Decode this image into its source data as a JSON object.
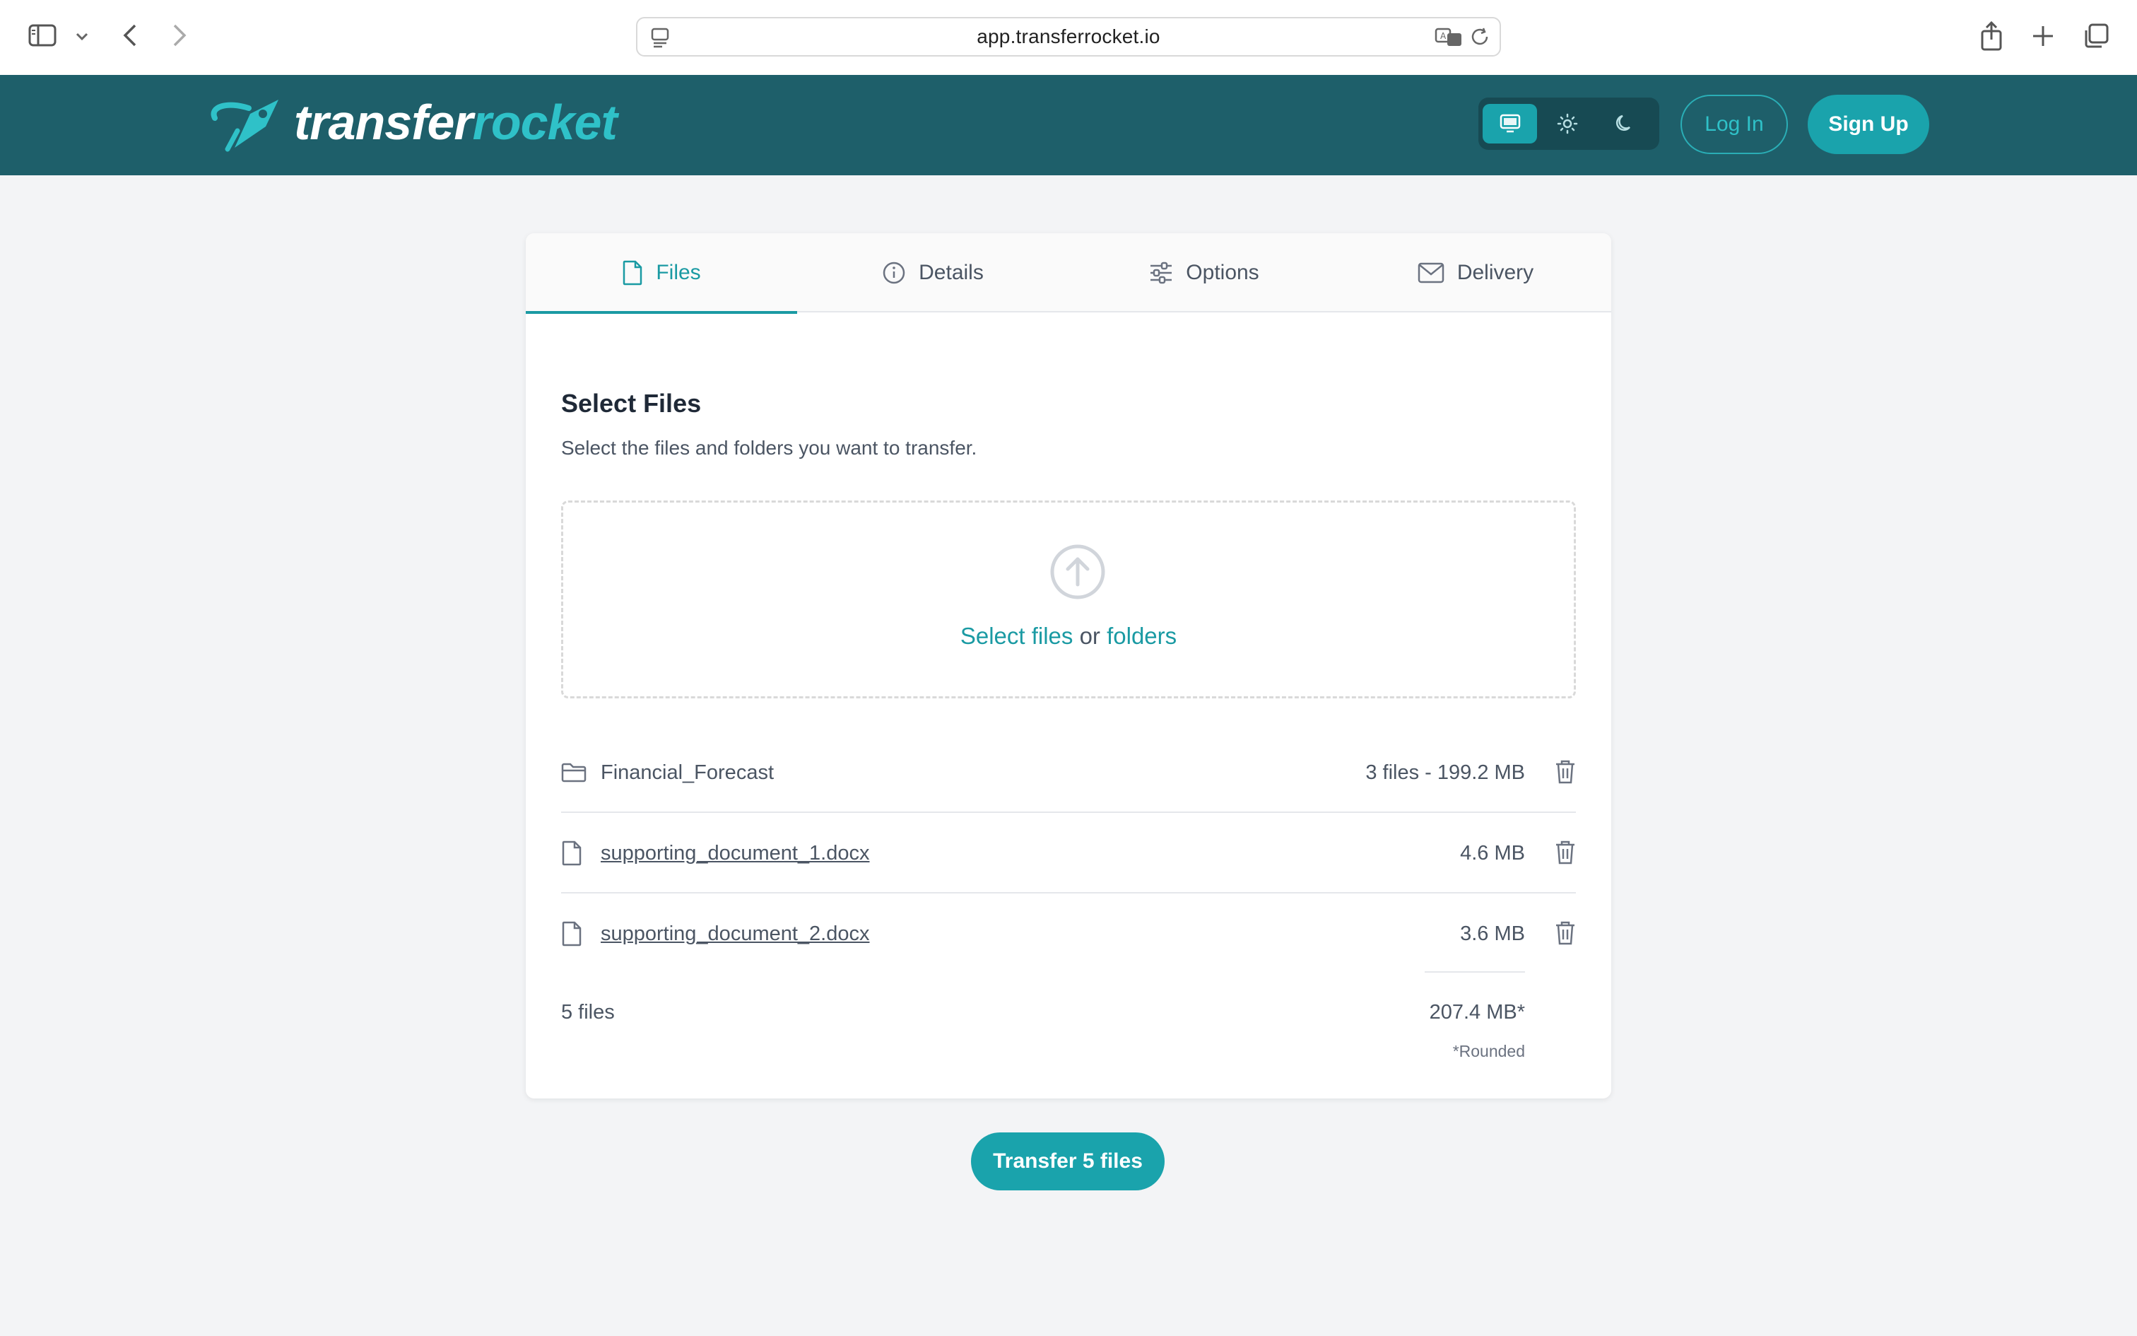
{
  "browser": {
    "url": "app.transferrocket.io"
  },
  "header": {
    "logo_part1": "transfer",
    "logo_part2": "rocket",
    "login_label": "Log In",
    "signup_label": "Sign Up",
    "theme_options": [
      "monitor-icon",
      "sun-icon",
      "moon-icon"
    ],
    "brand_color": "#1e5f6a",
    "accent_color": "#1aa3ac"
  },
  "tabs": [
    {
      "label": "Files",
      "icon": "file-icon",
      "active": true
    },
    {
      "label": "Details",
      "icon": "info-icon",
      "active": false
    },
    {
      "label": "Options",
      "icon": "sliders-icon",
      "active": false
    },
    {
      "label": "Delivery",
      "icon": "mail-icon",
      "active": false
    }
  ],
  "main": {
    "title": "Select Files",
    "subtitle": "Select the files and folders you want to transfer.",
    "dropzone": {
      "select_files": "Select files",
      "or": "or",
      "folders": "folders"
    },
    "files": [
      {
        "name": "Financial_Forecast",
        "size": "3 files - 199.2 MB",
        "type": "folder"
      },
      {
        "name": "supporting_document_1.docx",
        "size": "4.6 MB",
        "type": "file"
      },
      {
        "name": "supporting_document_2.docx",
        "size": "3.6 MB",
        "type": "file"
      }
    ],
    "total_count": "5 files",
    "total_size": "207.4 MB*",
    "rounded_note": "*Rounded"
  },
  "transfer_label": "Transfer 5 files"
}
